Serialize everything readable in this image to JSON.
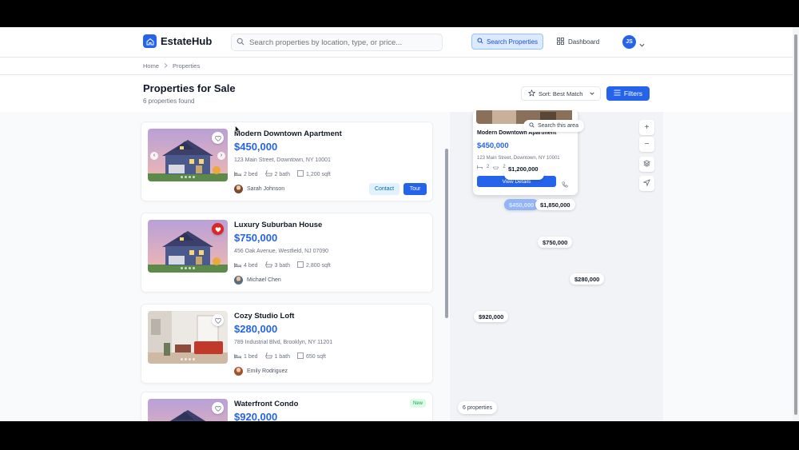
{
  "app": {
    "name": "EstateHub"
  },
  "header": {
    "search_placeholder": "Search properties by location, type, or price...",
    "search_button": "Search Properties",
    "dashboard": "Dashboard",
    "user_initials": "JS"
  },
  "breadcrumb": [
    "Home",
    "Properties"
  ],
  "page": {
    "title": "Properties for Sale",
    "subtitle": "6 properties found",
    "sort_label": "Sort: Best Match",
    "filters_label": "Filters"
  },
  "listings": [
    {
      "title": "Modern Downtown Apartment",
      "price": "$450,000",
      "address": "123 Main Street, Downtown, NY 10001",
      "beds": "2 bed",
      "baths": "2 bath",
      "sqft": "1,200 sqft",
      "agent": "Sarah Johnson",
      "favorite": false,
      "contact": "Contact",
      "tour": "Tour"
    },
    {
      "title": "Luxury Suburban House",
      "price": "$750,000",
      "address": "456 Oak Avenue, Westfield, NJ 07090",
      "beds": "4 bed",
      "baths": "3 bath",
      "sqft": "2,800 sqft",
      "agent": "Michael Chen",
      "favorite": true
    },
    {
      "title": "Cozy Studio Loft",
      "price": "$280,000",
      "address": "789 Industrial Blvd, Brooklyn, NY 11201",
      "beds": "1 bed",
      "baths": "1 bath",
      "sqft": "650 sqft",
      "agent": "Emily Rodriguez",
      "favorite": false
    },
    {
      "title": "Waterfront Condo",
      "price": "$920,000",
      "badge": "New",
      "favorite": false
    }
  ],
  "map": {
    "popup": {
      "title": "Modern Downtown Apartment",
      "price": "$450,000",
      "address": "123 Main Street, Downtown, NY 10001",
      "beds": "2",
      "baths": "2",
      "view_details": "View Details"
    },
    "search_area": "Search this area",
    "pins": [
      "$1,200,000",
      "$450,000",
      "$1,850,000",
      "$750,000",
      "$280,000",
      "$920,000"
    ],
    "count_label": "6 properties"
  },
  "colors": {
    "accent": "#2563eb",
    "price": "#2563eb",
    "favorite": "#dc2626",
    "new_badge": "#16a34a"
  }
}
